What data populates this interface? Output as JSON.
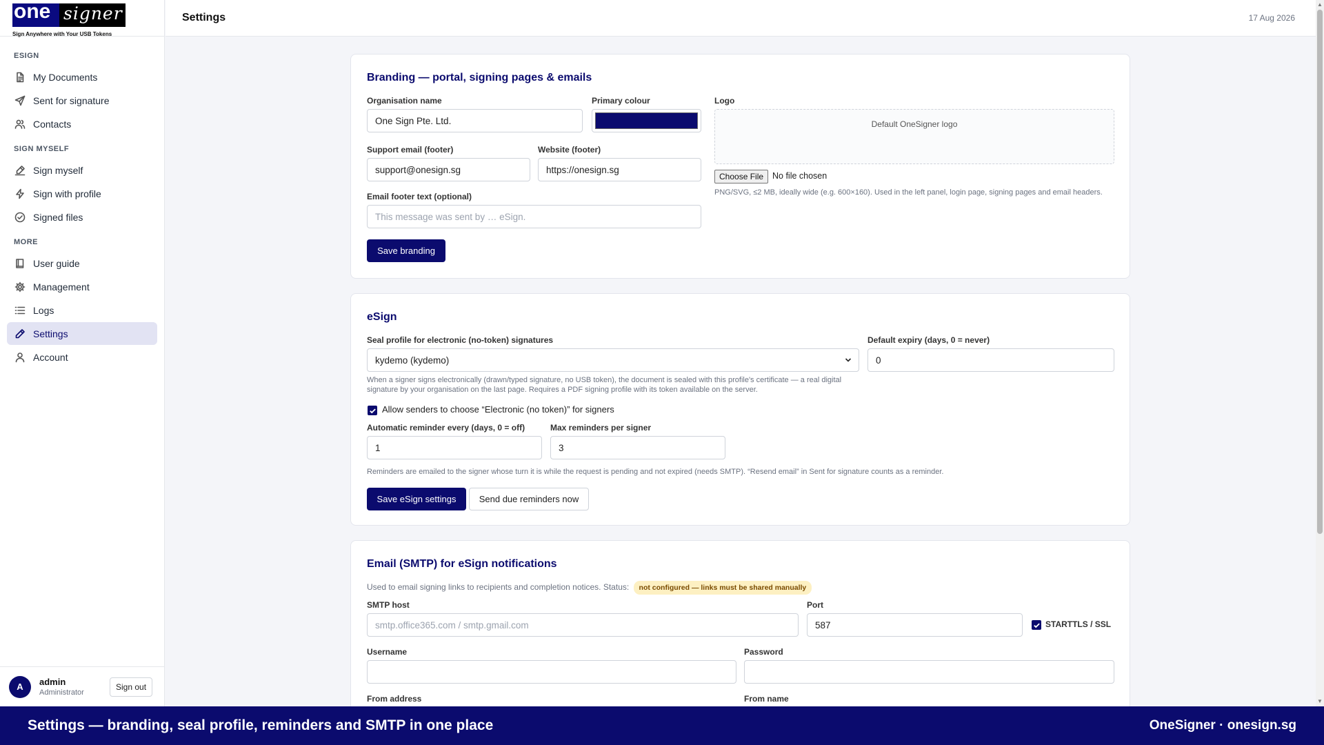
{
  "brand": {
    "logo_one": "one",
    "logo_signer": "signer",
    "tagline": "Sign Anywhere with Your USB Tokens",
    "primary_color": "#0b0b6e"
  },
  "sidebar": {
    "sections": [
      {
        "label": "ESIGN",
        "items": [
          {
            "label": "My Documents",
            "icon": "document-icon"
          },
          {
            "label": "Sent for signature",
            "icon": "send-icon"
          },
          {
            "label": "Contacts",
            "icon": "contacts-icon"
          }
        ]
      },
      {
        "label": "SIGN MYSELF",
        "items": [
          {
            "label": "Sign myself",
            "icon": "signature-icon"
          },
          {
            "label": "Sign with profile",
            "icon": "lightning-icon"
          },
          {
            "label": "Signed files",
            "icon": "check-circle-icon"
          }
        ]
      },
      {
        "label": "MORE",
        "items": [
          {
            "label": "User guide",
            "icon": "book-icon"
          },
          {
            "label": "Management",
            "icon": "gear-icon"
          },
          {
            "label": "Logs",
            "icon": "list-icon"
          },
          {
            "label": "Settings",
            "icon": "pen-icon",
            "active": true
          },
          {
            "label": "Account",
            "icon": "user-icon"
          }
        ]
      }
    ],
    "user": {
      "initial": "A",
      "name": "admin",
      "role": "Administrator",
      "signout_label": "Sign out"
    }
  },
  "header": {
    "title": "Settings",
    "date": "17 Aug 2026"
  },
  "branding": {
    "title": "Branding — portal, signing pages & emails",
    "org_name_label": "Organisation name",
    "org_name_value": "One Sign Pte. Ltd.",
    "primary_colour_label": "Primary colour",
    "primary_colour_value": "#0b0b6e",
    "logo_label": "Logo",
    "logo_default_text": "Default OneSigner logo",
    "choose_file_label": "Choose File",
    "no_file_text": "No file chosen",
    "logo_help": "PNG/SVG, ≤2 MB, ideally wide (e.g. 600×160). Used in the left panel, login page, signing pages and email headers.",
    "support_email_label": "Support email (footer)",
    "support_email_value": "support@onesign.sg",
    "website_label": "Website (footer)",
    "website_value": "https://onesign.sg",
    "footer_text_label": "Email footer text (optional)",
    "footer_text_placeholder": "This message was sent by … eSign.",
    "save_label": "Save branding"
  },
  "esign": {
    "title": "eSign",
    "seal_label": "Seal profile for electronic (no-token) signatures",
    "seal_value": "kydemo (kydemo)",
    "expiry_label": "Default expiry (days, 0 = never)",
    "expiry_value": "0",
    "seal_help": "When a signer signs electronically (drawn/typed signature, no USB token), the document is sealed with this profile's certificate — a real digital signature by your organisation on the last page. Requires a PDF signing profile with its token available on the server.",
    "allow_label": "Allow senders to choose “Electronic (no token)” for signers",
    "allow_checked": true,
    "reminder_label": "Automatic reminder every (days, 0 = off)",
    "reminder_value": "1",
    "max_reminders_label": "Max reminders per signer",
    "max_reminders_value": "3",
    "reminder_help": "Reminders are emailed to the signer whose turn it is while the request is pending and not expired (needs SMTP). “Resend email” in Sent for signature counts as a reminder.",
    "save_label": "Save eSign settings",
    "send_label": "Send due reminders now"
  },
  "smtp": {
    "title": "Email (SMTP) for eSign notifications",
    "intro": "Used to email signing links to recipients and completion notices. Status:",
    "status_badge": "not configured — links must be shared manually",
    "host_label": "SMTP host",
    "host_placeholder": "smtp.office365.com / smtp.gmail.com",
    "port_label": "Port",
    "port_value": "587",
    "tls_label": "STARTTLS / SSL",
    "tls_checked": true,
    "username_label": "Username",
    "password_label": "Password",
    "from_address_label": "From address",
    "from_name_label": "From name"
  },
  "banner": {
    "left": "Settings — branding, seal profile, reminders and SMTP in one place",
    "right": "OneSigner · onesign.sg"
  }
}
